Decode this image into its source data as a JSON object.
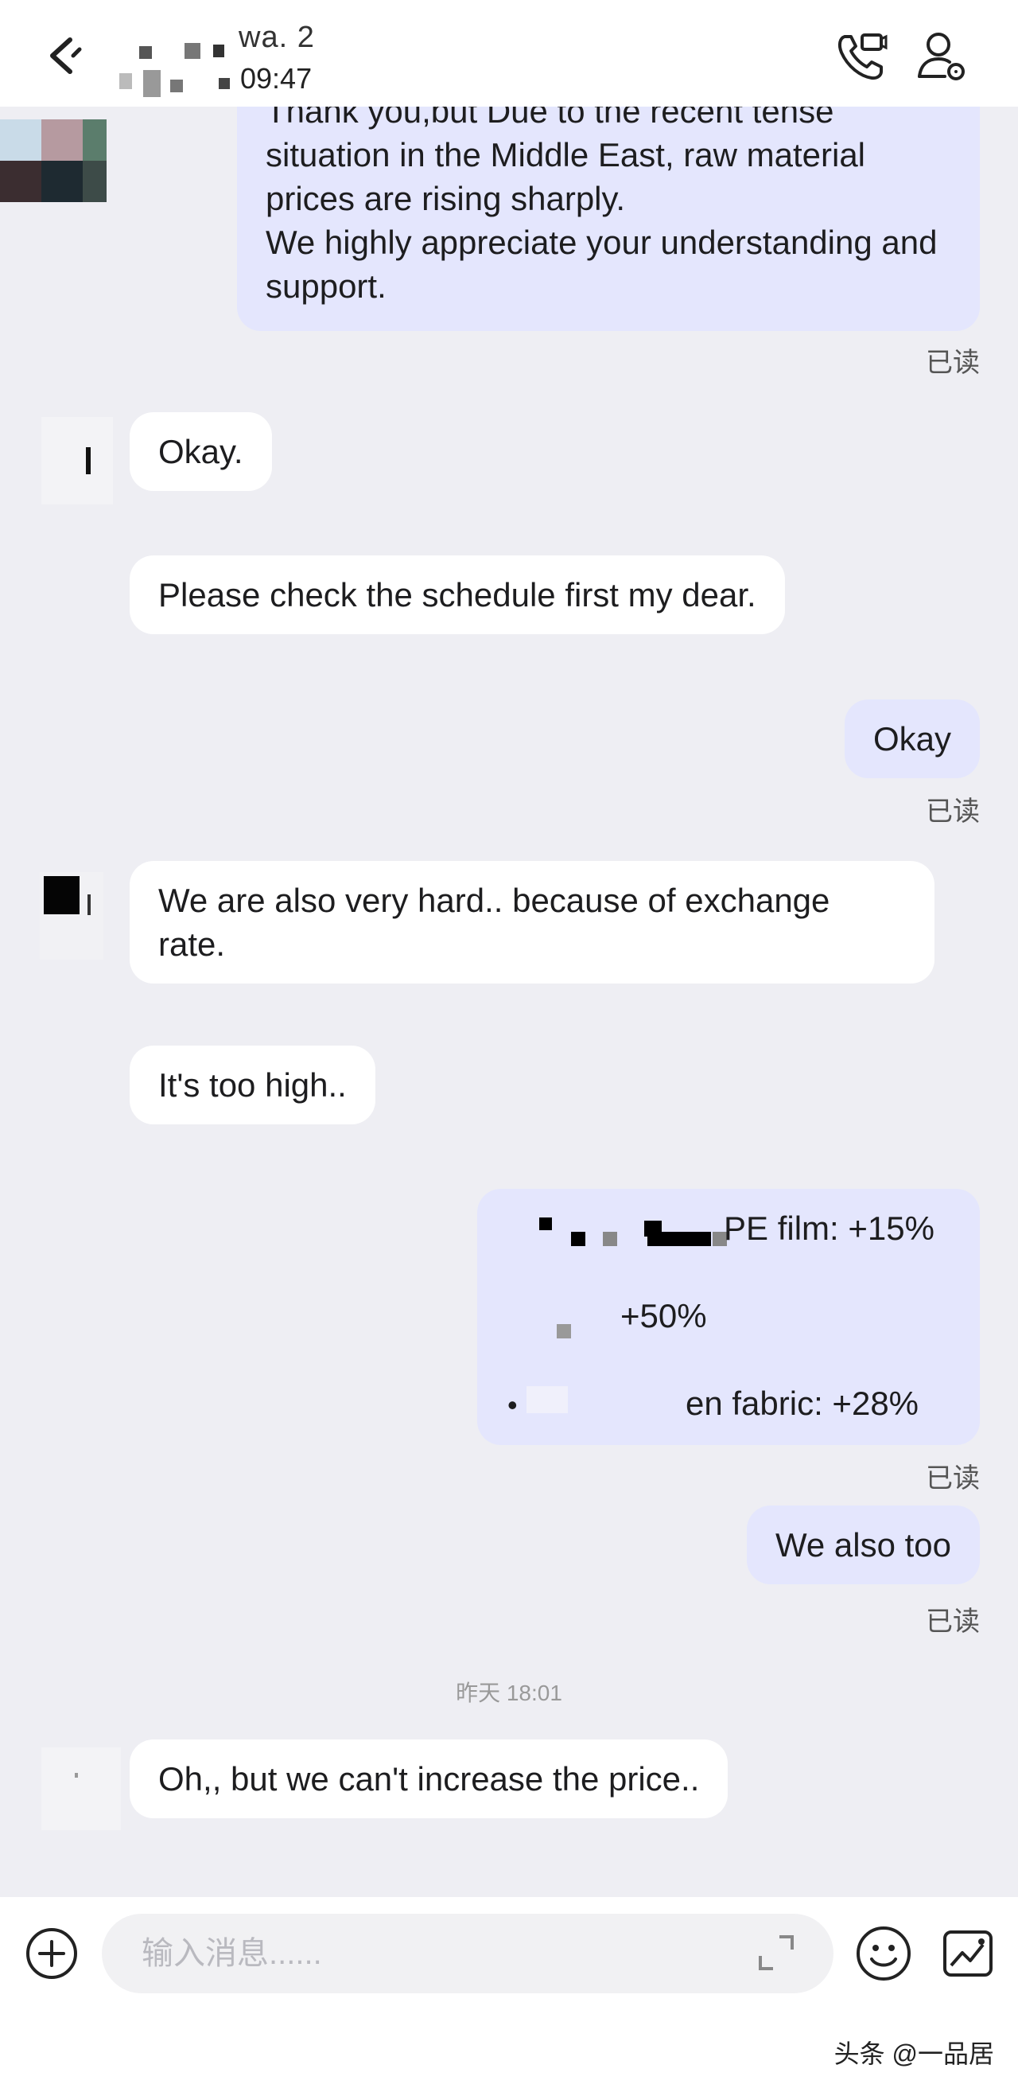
{
  "header": {
    "title": "wa. 2",
    "subtitle": "09:47",
    "accent": "#e4e6fd"
  },
  "messages": [
    {
      "side": "out",
      "text": "Thank you,but Due to the recent tense situation in the Middle East, raw material prices are rising sharply.\nWe highly appreciate your understanding and support.",
      "status": "已读"
    },
    {
      "side": "in",
      "text": "Okay."
    },
    {
      "side": "in",
      "text": "Please check the schedule first my dear."
    },
    {
      "side": "out",
      "text": "Okay",
      "status": "已读"
    },
    {
      "side": "in",
      "text": "We are also very hard.. because of exchange rate."
    },
    {
      "side": "in",
      "text": "It's too high.."
    },
    {
      "side": "out",
      "lines": [
        "PE film: +15%",
        "+50%",
        "en fabric: +28%"
      ],
      "status": "已读"
    },
    {
      "side": "out",
      "text": "We also too",
      "status": "已读"
    },
    {
      "side": "in",
      "text": "Oh,, but we can't increase the price.."
    }
  ],
  "timestamp": "昨天 18:01",
  "input": {
    "placeholder": "输入消息......"
  },
  "icons": [
    "back-arrow-icon",
    "phone-call-icon",
    "profile-icon",
    "plus-circle-icon",
    "expand-icon",
    "emoji-icon",
    "album-icon"
  ],
  "watermark": "头条 @一品居"
}
